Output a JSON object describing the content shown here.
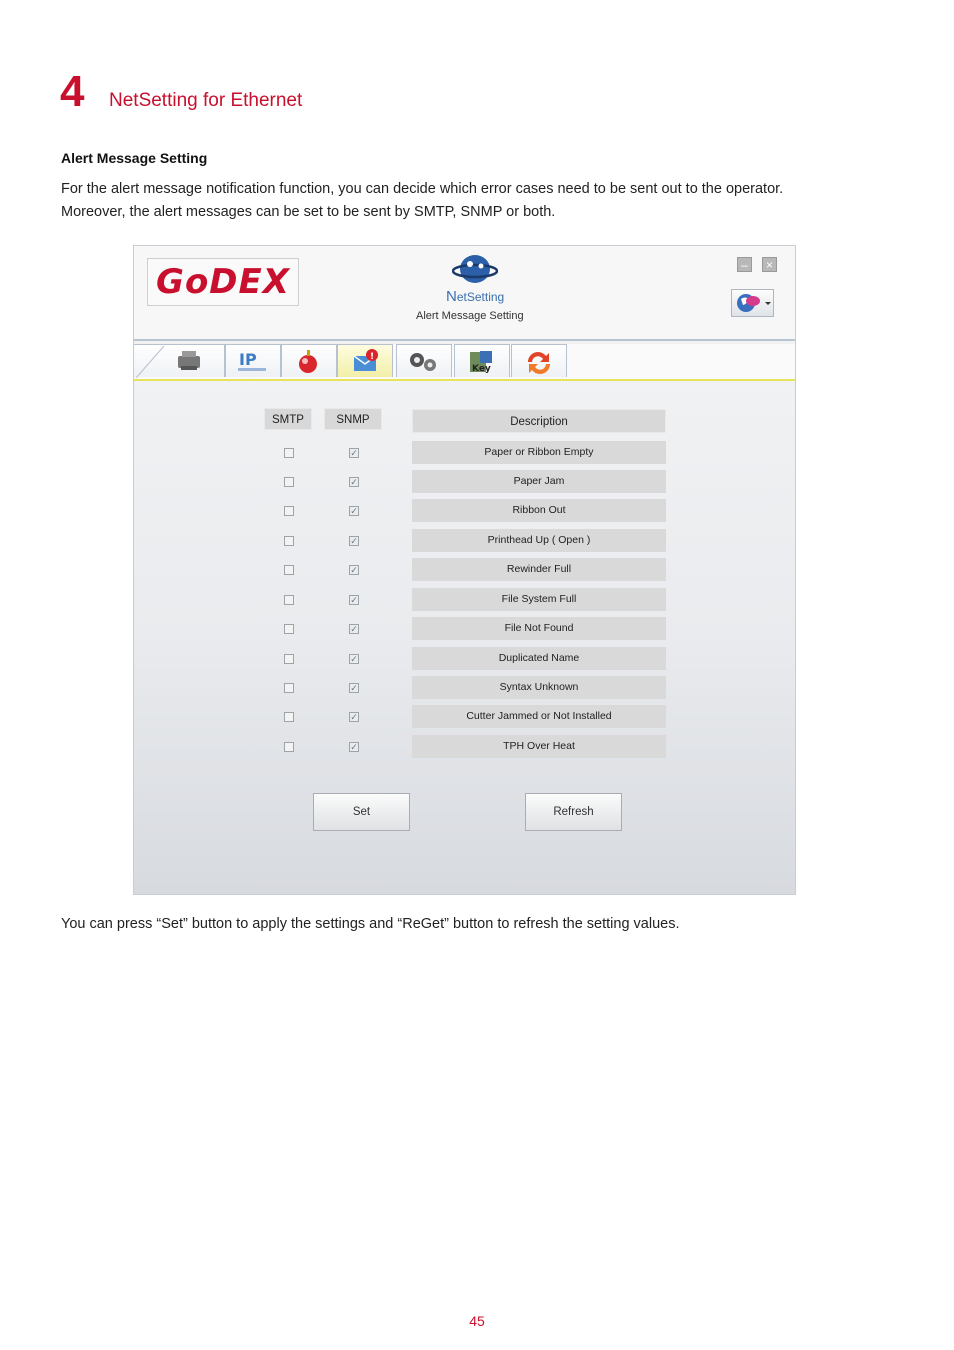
{
  "chapter": {
    "number": "4",
    "title": "NetSetting for Ethernet"
  },
  "section": {
    "heading": "Alert Message Setting",
    "intro_line1": "For the alert message notification function, you can decide which error cases need to be sent out to the operator.",
    "intro_line2": "Moreover, the alert messages can be set to be sent by SMTP, SNMP or both."
  },
  "app": {
    "logo_text": "GoDEX",
    "brand_prefix": "N",
    "brand_suffix": "etSetting",
    "window_caption": "Alert Message Setting",
    "tabs": [
      {
        "name": "printer-settings",
        "icon": "printer-icon"
      },
      {
        "name": "ip-settings",
        "icon": "ip-network-icon"
      },
      {
        "name": "email-settings",
        "icon": "email-icon"
      },
      {
        "name": "alert-message",
        "icon": "alert-mail-icon",
        "active": true
      },
      {
        "name": "configuration",
        "icon": "gears-icon"
      },
      {
        "name": "password",
        "icon": "key-icon"
      },
      {
        "name": "update",
        "icon": "refresh-icon"
      }
    ],
    "columns": {
      "smtp": "SMTP",
      "snmp": "SNMP",
      "description": "Description"
    },
    "rows": [
      {
        "description": "Paper or Ribbon Empty",
        "smtp": false,
        "snmp": true
      },
      {
        "description": "Paper Jam",
        "smtp": false,
        "snmp": true
      },
      {
        "description": "Ribbon Out",
        "smtp": false,
        "snmp": true
      },
      {
        "description": "Printhead Up ( Open )",
        "smtp": false,
        "snmp": true
      },
      {
        "description": "Rewinder Full",
        "smtp": false,
        "snmp": true
      },
      {
        "description": "File System Full",
        "smtp": false,
        "snmp": true
      },
      {
        "description": "File Not Found",
        "smtp": false,
        "snmp": true
      },
      {
        "description": "Duplicated Name",
        "smtp": false,
        "snmp": true
      },
      {
        "description": "Syntax Unknown",
        "smtp": false,
        "snmp": true
      },
      {
        "description": "Cutter Jammed or Not Installed",
        "smtp": false,
        "snmp": true
      },
      {
        "description": "TPH Over Heat",
        "smtp": false,
        "snmp": true
      }
    ],
    "buttons": {
      "set": "Set",
      "refresh": "Refresh"
    },
    "colors": {
      "brand_red": "#c8102e",
      "active_tab": "#f2efa8"
    }
  },
  "footer_text": "You can press “Set” button to apply the settings and “ReGet” button to refresh the setting values.",
  "page_number": "45"
}
